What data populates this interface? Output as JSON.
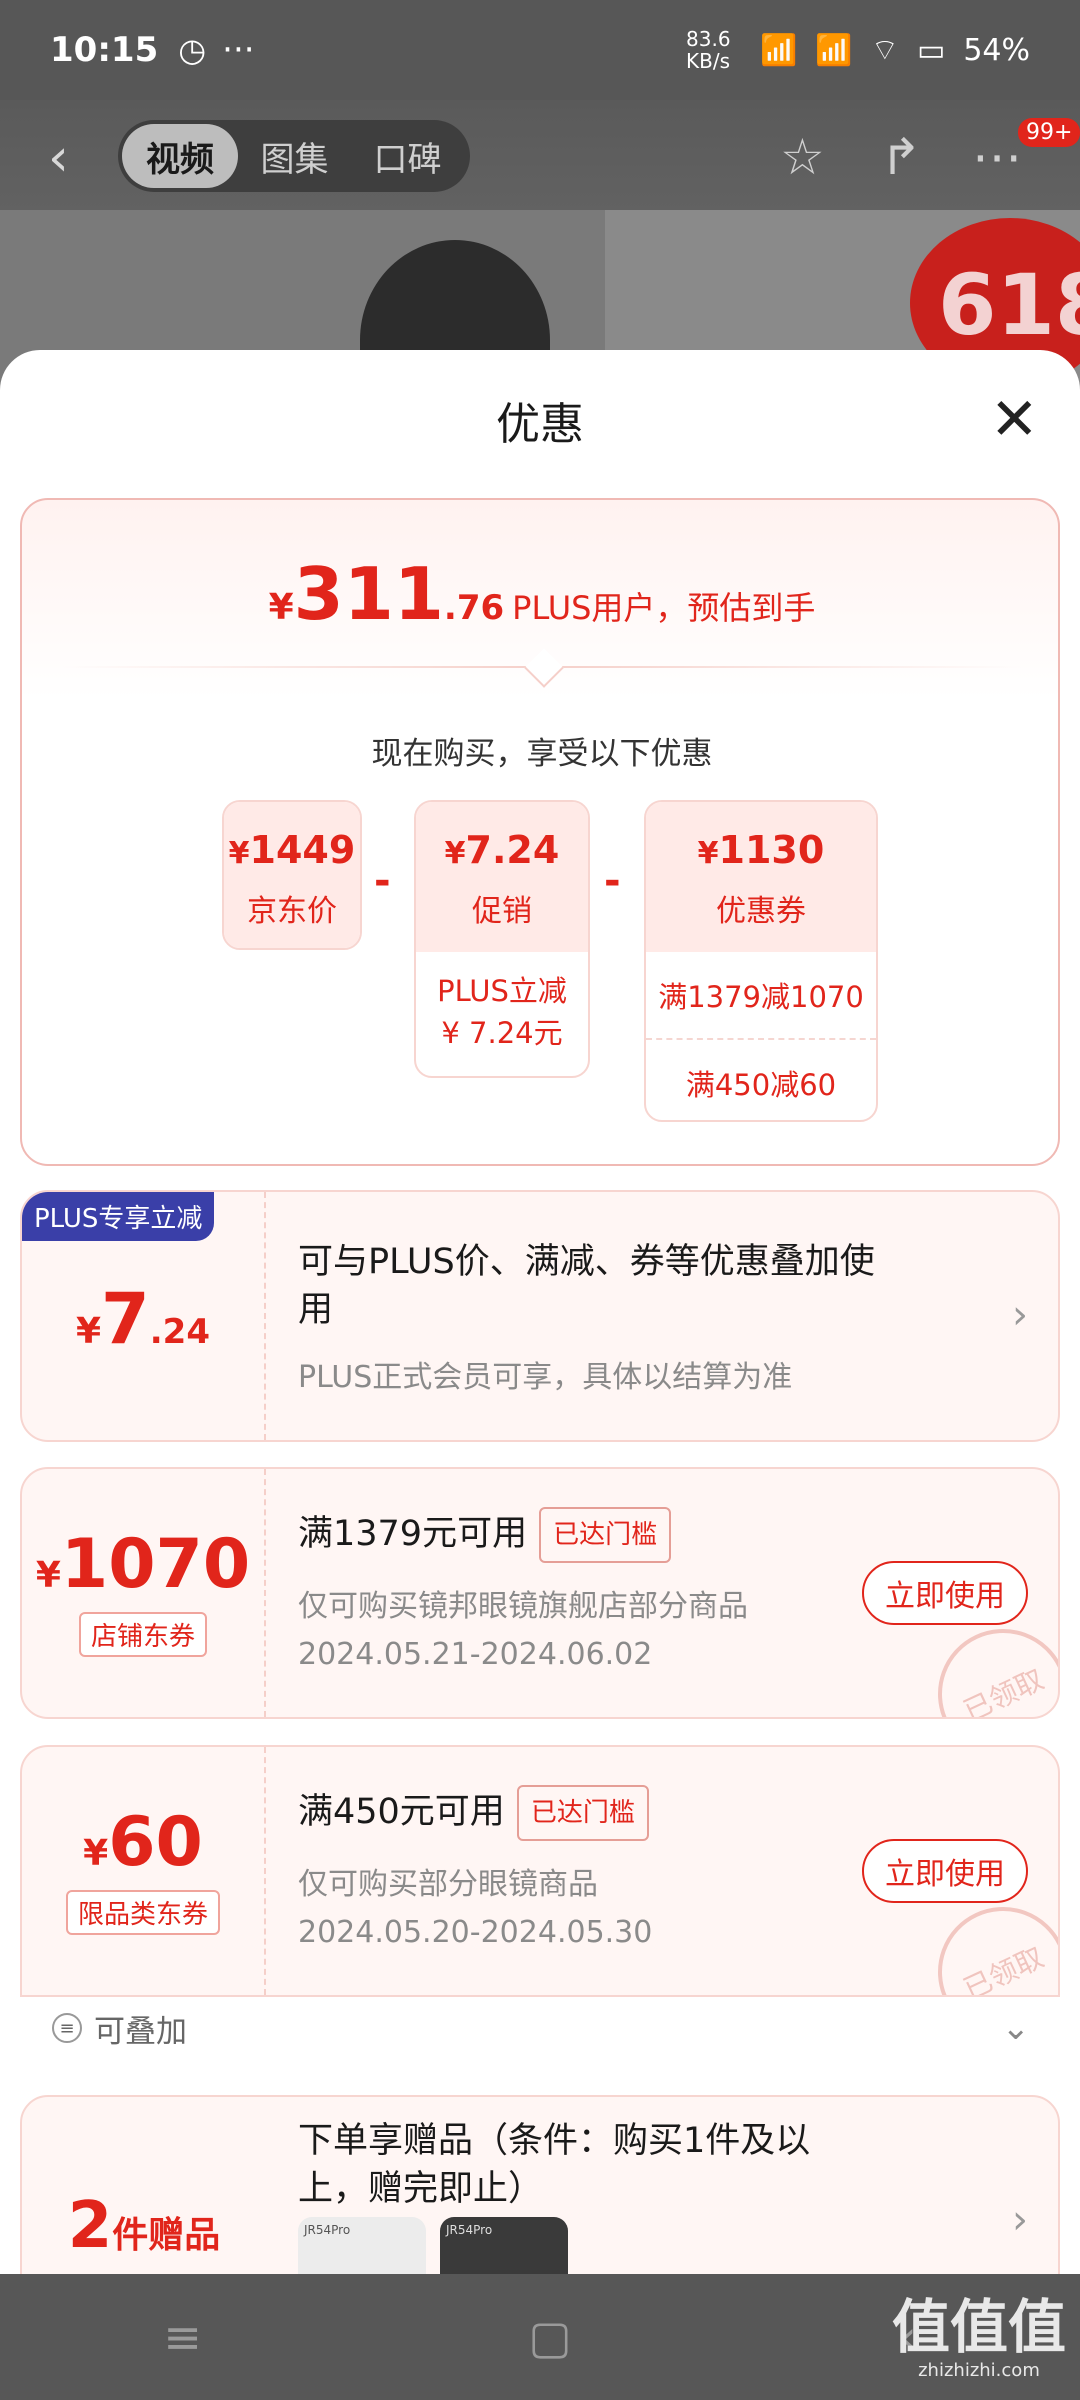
{
  "status_bar": {
    "time": "10:15",
    "more": "···",
    "speed": "83.6 KB/s",
    "battery": "54%"
  },
  "top_nav": {
    "tabs": [
      "视频",
      "图集",
      "口碑"
    ],
    "badge": "99+",
    "promo_badge": "618"
  },
  "sheet": {
    "title": "优惠",
    "estimate": {
      "currency": "¥",
      "integer": "311",
      "decimal": ".76",
      "label": "PLUS用户，预估到手"
    },
    "subtitle": "现在购买，享受以下优惠",
    "boxes": [
      {
        "currency": "¥",
        "amount": "1449",
        "name": "京东价",
        "rows": []
      },
      {
        "currency": "¥",
        "amount": "7.24",
        "name": "促销",
        "rows": [
          "PLUS立减\n¥ 7.24元"
        ]
      },
      {
        "currency": "¥",
        "amount": "1130",
        "name": "优惠券",
        "rows": [
          "满1379减1070",
          "满450减60"
        ]
      }
    ],
    "minus": "-"
  },
  "plus_card": {
    "badge": "PLUS专享立减",
    "currency": "¥",
    "amount_int": "7",
    "amount_dec": ".24",
    "title": "可与PLUS价、满减、券等优惠叠加使用",
    "sub": "PLUS正式会员可享，具体以结算为准"
  },
  "coupons": [
    {
      "currency": "¥",
      "amount": "1070",
      "type": "店铺东券",
      "title": "满1379元可用",
      "tag": "已达门槛",
      "desc": "仅可购买镜邦眼镜旗舰店部分商品",
      "dates": "2024.05.21-2024.06.02",
      "button": "立即使用",
      "stamp": "已领取"
    },
    {
      "currency": "¥",
      "amount": "60",
      "type": "限品类东券",
      "title": "满450元可用",
      "tag": "已达门槛",
      "desc": "仅可购买部分眼镜商品",
      "dates": "2024.05.20-2024.05.30",
      "button": "立即使用",
      "stamp": "已领取"
    }
  ],
  "stackable": {
    "label": "可叠加"
  },
  "gift": {
    "count": "2",
    "unit": "件赠品",
    "title": "下单享赠品（条件：购买1件及以上，赠完即止）",
    "thumb_labels": [
      "JR54Pro",
      "JR54Pro"
    ]
  },
  "watermark": {
    "text": "值值值",
    "domain": "zhizhizhi.com"
  },
  "colors": {
    "accent": "#e1251b",
    "plus_badge": "#3a3fa8"
  }
}
